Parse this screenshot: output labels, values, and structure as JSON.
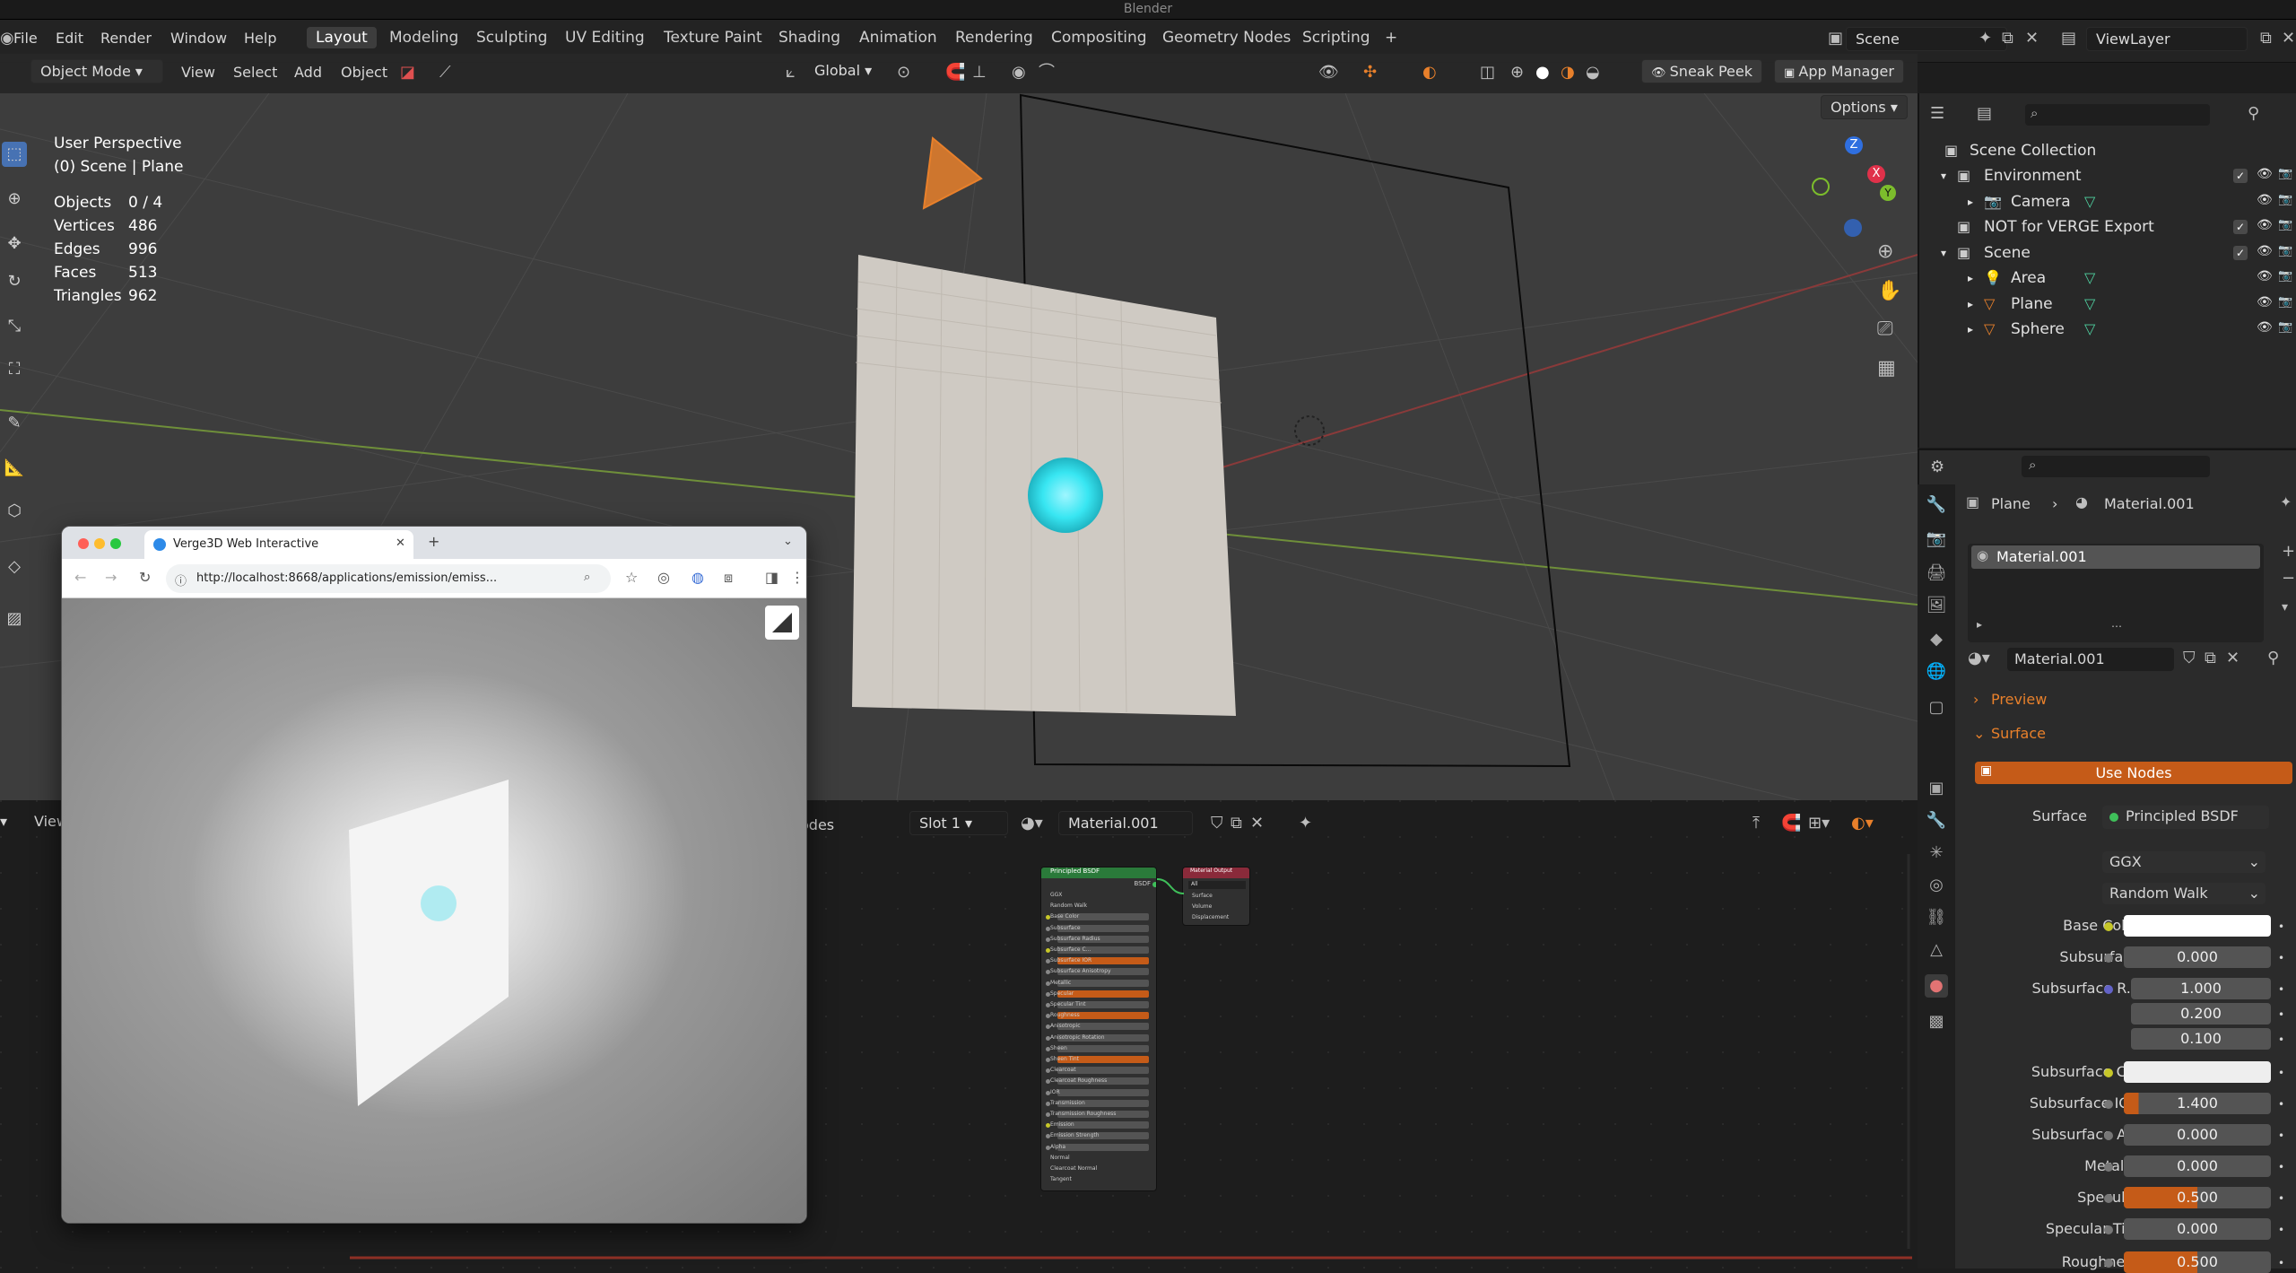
{
  "window_title": "Blender",
  "menu": [
    "File",
    "Edit",
    "Render",
    "Window",
    "Help"
  ],
  "workspaces": [
    "Layout",
    "Modeling",
    "Sculpting",
    "UV Editing",
    "Texture Paint",
    "Shading",
    "Animation",
    "Rendering",
    "Compositing",
    "Geometry Nodes",
    "Scripting"
  ],
  "active_workspace": "Layout",
  "scene_field": "Scene",
  "viewlayer_field": "ViewLayer",
  "viewport_header": {
    "mode": "Object Mode",
    "menus": [
      "View",
      "Select",
      "Add",
      "Object"
    ],
    "orientation": "Global",
    "sneak_peek": "Sneak Peek",
    "app_manager": "App Manager",
    "options": "Options"
  },
  "viewport_overlay": {
    "perspective": "User Perspective",
    "context": "(0) Scene | Plane",
    "stats": [
      {
        "label": "Objects",
        "value": "0 / 4"
      },
      {
        "label": "Vertices",
        "value": "486"
      },
      {
        "label": "Edges",
        "value": "996"
      },
      {
        "label": "Faces",
        "value": "513"
      },
      {
        "label": "Triangles",
        "value": "962"
      }
    ]
  },
  "gizmo": {
    "z": "Z",
    "x": "X",
    "y": "Y"
  },
  "outliner": {
    "root": "Scene Collection",
    "rows": [
      {
        "label": "Environment",
        "indent": 1
      },
      {
        "label": "Camera",
        "indent": 2
      },
      {
        "label": "NOT for VERGE Export",
        "indent": 1
      },
      {
        "label": "Scene",
        "indent": 1
      },
      {
        "label": "Area",
        "indent": 2
      },
      {
        "label": "Plane",
        "indent": 2
      },
      {
        "label": "Sphere",
        "indent": 2
      }
    ]
  },
  "properties": {
    "breadcrumb_object": "Plane",
    "breadcrumb_material": "Material.001",
    "slot_name": "Material.001",
    "material_field": "Material.001",
    "preview_label": "Preview",
    "surface_label": "Surface",
    "use_nodes": "Use Nodes",
    "surface_shader_label": "Surface",
    "surface_shader": "Principled BSDF",
    "distribution": "GGX",
    "subsurface_method": "Random Walk",
    "rows": [
      {
        "label": "Base Color",
        "value": "",
        "kind": "color"
      },
      {
        "label": "Subsurface",
        "value": "0.000",
        "kind": "num"
      },
      {
        "label": "Subsurface R...",
        "value": "1.000",
        "kind": "vec"
      },
      {
        "label": "",
        "value": "0.200",
        "kind": "vec"
      },
      {
        "label": "",
        "value": "0.100",
        "kind": "vec"
      },
      {
        "label": "Subsurface C...",
        "value": "",
        "kind": "color"
      },
      {
        "label": "Subsurface IOR",
        "value": "1.400",
        "kind": "ior"
      },
      {
        "label": "Subsurface A...",
        "value": "0.000",
        "kind": "num"
      },
      {
        "label": "Metallic",
        "value": "0.000",
        "kind": "num"
      },
      {
        "label": "Specular",
        "value": "0.500",
        "kind": "orange"
      },
      {
        "label": "Specular Tint",
        "value": "0.000",
        "kind": "num"
      },
      {
        "label": "Roughness",
        "value": "0.500",
        "kind": "orange"
      }
    ]
  },
  "node_editor": {
    "view_label": "View",
    "nodes_label": "odes",
    "slot": "Slot 1",
    "material": "Material.001",
    "bsdf_title": "Principled BSDF",
    "bsdf_out": "BSDF",
    "output_title": "Material Output",
    "output_target": "All",
    "output_sockets": [
      "Surface",
      "Volume",
      "Displacement"
    ],
    "bsdf_rows": [
      "GGX",
      "Random Walk",
      "Base Color",
      "Subsurface",
      "Subsurface Radius",
      "Subsurface C...",
      "Subsurface IOR",
      "Subsurface Anisotropy",
      "Metallic",
      "Specular",
      "Specular Tint",
      "Roughness",
      "Anisotropic",
      "Anisotropic Rotation",
      "Sheen",
      "Sheen Tint",
      "Clearcoat",
      "Clearcoat Roughness",
      "IOR",
      "Transmission",
      "Transmission Roughness",
      "Emission",
      "Emission Strength",
      "Alpha",
      "Normal",
      "Clearcoat Normal",
      "Tangent"
    ]
  },
  "browser": {
    "tab_title": "Verge3D Web Interactive",
    "url": "http://localhost:8668/applications/emission/emiss..."
  },
  "colors": {
    "accent": "#4772b3",
    "orange": "#c55b18",
    "selection_cyan": "#38e6f2"
  }
}
